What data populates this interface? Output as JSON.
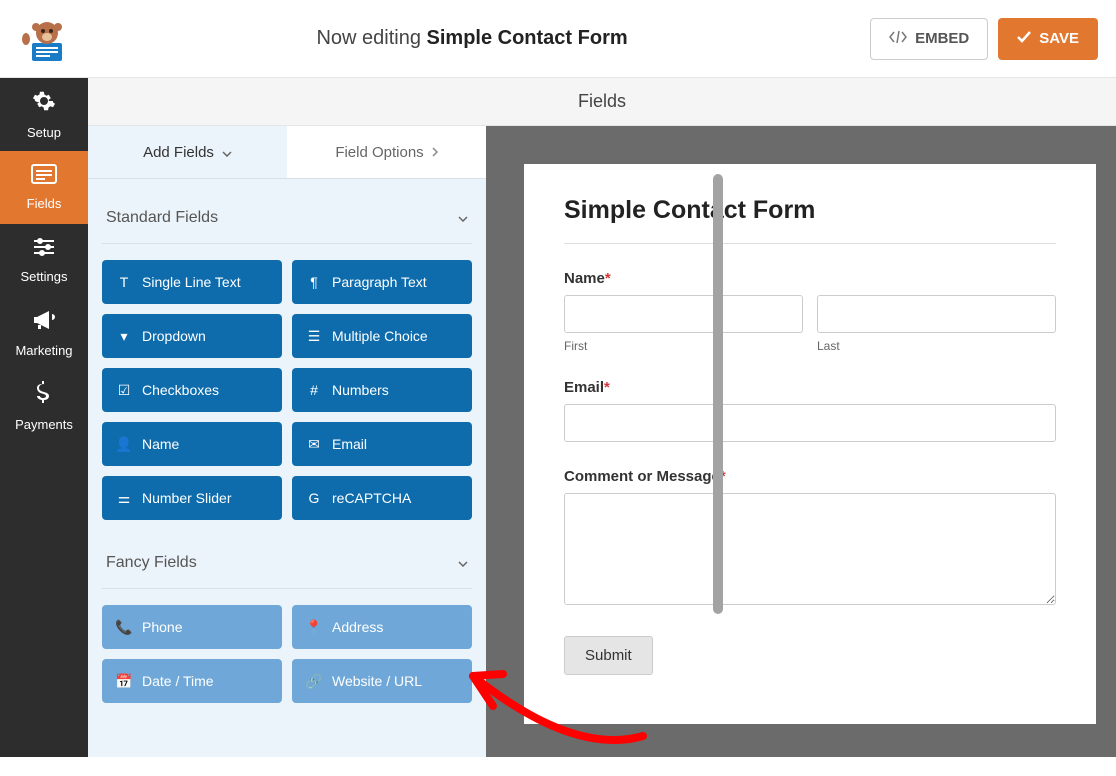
{
  "header": {
    "now_editing": "Now editing",
    "form_name": "Simple Contact Form",
    "embed": "EMBED",
    "save": "SAVE"
  },
  "sidebar": {
    "items": [
      {
        "label": "Setup"
      },
      {
        "label": "Fields"
      },
      {
        "label": "Settings"
      },
      {
        "label": "Marketing"
      },
      {
        "label": "Payments"
      }
    ]
  },
  "subheader": {
    "title": "Fields"
  },
  "tabs": {
    "add_fields": "Add Fields",
    "field_options": "Field Options"
  },
  "sections": {
    "standard": "Standard Fields",
    "fancy": "Fancy Fields"
  },
  "standard_fields": [
    "Single Line Text",
    "Paragraph Text",
    "Dropdown",
    "Multiple Choice",
    "Checkboxes",
    "Numbers",
    "Name",
    "Email",
    "Number Slider",
    "reCAPTCHA"
  ],
  "fancy_fields": [
    "Phone",
    "Address",
    "Date / Time",
    "Website / URL"
  ],
  "preview": {
    "title": "Simple Contact Form",
    "name_label": "Name",
    "first": "First",
    "last": "Last",
    "email_label": "Email",
    "comment_label": "Comment or Message",
    "submit": "Submit"
  }
}
